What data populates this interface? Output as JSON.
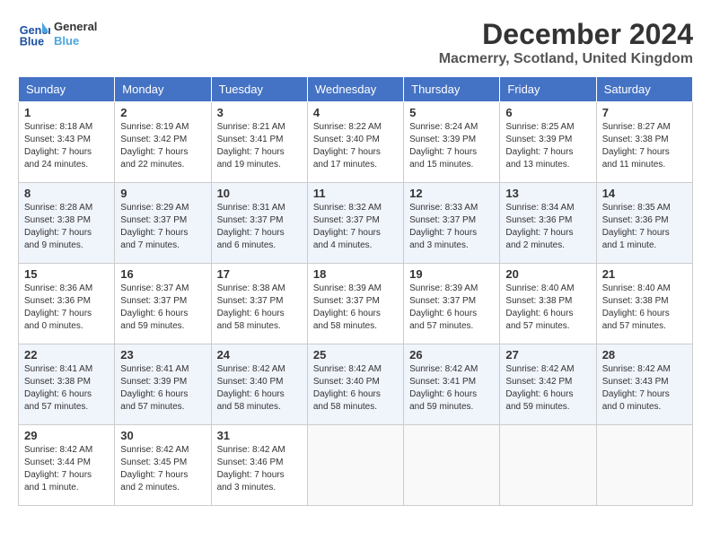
{
  "header": {
    "logo_line1": "General",
    "logo_line2": "Blue",
    "month": "December 2024",
    "location": "Macmerry, Scotland, United Kingdom"
  },
  "days_of_week": [
    "Sunday",
    "Monday",
    "Tuesday",
    "Wednesday",
    "Thursday",
    "Friday",
    "Saturday"
  ],
  "weeks": [
    [
      {
        "day": "1",
        "info": "Sunrise: 8:18 AM\nSunset: 3:43 PM\nDaylight: 7 hours\nand 24 minutes."
      },
      {
        "day": "2",
        "info": "Sunrise: 8:19 AM\nSunset: 3:42 PM\nDaylight: 7 hours\nand 22 minutes."
      },
      {
        "day": "3",
        "info": "Sunrise: 8:21 AM\nSunset: 3:41 PM\nDaylight: 7 hours\nand 19 minutes."
      },
      {
        "day": "4",
        "info": "Sunrise: 8:22 AM\nSunset: 3:40 PM\nDaylight: 7 hours\nand 17 minutes."
      },
      {
        "day": "5",
        "info": "Sunrise: 8:24 AM\nSunset: 3:39 PM\nDaylight: 7 hours\nand 15 minutes."
      },
      {
        "day": "6",
        "info": "Sunrise: 8:25 AM\nSunset: 3:39 PM\nDaylight: 7 hours\nand 13 minutes."
      },
      {
        "day": "7",
        "info": "Sunrise: 8:27 AM\nSunset: 3:38 PM\nDaylight: 7 hours\nand 11 minutes."
      }
    ],
    [
      {
        "day": "8",
        "info": "Sunrise: 8:28 AM\nSunset: 3:38 PM\nDaylight: 7 hours\nand 9 minutes."
      },
      {
        "day": "9",
        "info": "Sunrise: 8:29 AM\nSunset: 3:37 PM\nDaylight: 7 hours\nand 7 minutes."
      },
      {
        "day": "10",
        "info": "Sunrise: 8:31 AM\nSunset: 3:37 PM\nDaylight: 7 hours\nand 6 minutes."
      },
      {
        "day": "11",
        "info": "Sunrise: 8:32 AM\nSunset: 3:37 PM\nDaylight: 7 hours\nand 4 minutes."
      },
      {
        "day": "12",
        "info": "Sunrise: 8:33 AM\nSunset: 3:37 PM\nDaylight: 7 hours\nand 3 minutes."
      },
      {
        "day": "13",
        "info": "Sunrise: 8:34 AM\nSunset: 3:36 PM\nDaylight: 7 hours\nand 2 minutes."
      },
      {
        "day": "14",
        "info": "Sunrise: 8:35 AM\nSunset: 3:36 PM\nDaylight: 7 hours\nand 1 minute."
      }
    ],
    [
      {
        "day": "15",
        "info": "Sunrise: 8:36 AM\nSunset: 3:36 PM\nDaylight: 7 hours\nand 0 minutes."
      },
      {
        "day": "16",
        "info": "Sunrise: 8:37 AM\nSunset: 3:37 PM\nDaylight: 6 hours\nand 59 minutes."
      },
      {
        "day": "17",
        "info": "Sunrise: 8:38 AM\nSunset: 3:37 PM\nDaylight: 6 hours\nand 58 minutes."
      },
      {
        "day": "18",
        "info": "Sunrise: 8:39 AM\nSunset: 3:37 PM\nDaylight: 6 hours\nand 58 minutes."
      },
      {
        "day": "19",
        "info": "Sunrise: 8:39 AM\nSunset: 3:37 PM\nDaylight: 6 hours\nand 57 minutes."
      },
      {
        "day": "20",
        "info": "Sunrise: 8:40 AM\nSunset: 3:38 PM\nDaylight: 6 hours\nand 57 minutes."
      },
      {
        "day": "21",
        "info": "Sunrise: 8:40 AM\nSunset: 3:38 PM\nDaylight: 6 hours\nand 57 minutes."
      }
    ],
    [
      {
        "day": "22",
        "info": "Sunrise: 8:41 AM\nSunset: 3:38 PM\nDaylight: 6 hours\nand 57 minutes."
      },
      {
        "day": "23",
        "info": "Sunrise: 8:41 AM\nSunset: 3:39 PM\nDaylight: 6 hours\nand 57 minutes."
      },
      {
        "day": "24",
        "info": "Sunrise: 8:42 AM\nSunset: 3:40 PM\nDaylight: 6 hours\nand 58 minutes."
      },
      {
        "day": "25",
        "info": "Sunrise: 8:42 AM\nSunset: 3:40 PM\nDaylight: 6 hours\nand 58 minutes."
      },
      {
        "day": "26",
        "info": "Sunrise: 8:42 AM\nSunset: 3:41 PM\nDaylight: 6 hours\nand 59 minutes."
      },
      {
        "day": "27",
        "info": "Sunrise: 8:42 AM\nSunset: 3:42 PM\nDaylight: 6 hours\nand 59 minutes."
      },
      {
        "day": "28",
        "info": "Sunrise: 8:42 AM\nSunset: 3:43 PM\nDaylight: 7 hours\nand 0 minutes."
      }
    ],
    [
      {
        "day": "29",
        "info": "Sunrise: 8:42 AM\nSunset: 3:44 PM\nDaylight: 7 hours\nand 1 minute."
      },
      {
        "day": "30",
        "info": "Sunrise: 8:42 AM\nSunset: 3:45 PM\nDaylight: 7 hours\nand 2 minutes."
      },
      {
        "day": "31",
        "info": "Sunrise: 8:42 AM\nSunset: 3:46 PM\nDaylight: 7 hours\nand 3 minutes."
      },
      {
        "day": "",
        "info": ""
      },
      {
        "day": "",
        "info": ""
      },
      {
        "day": "",
        "info": ""
      },
      {
        "day": "",
        "info": ""
      }
    ]
  ]
}
